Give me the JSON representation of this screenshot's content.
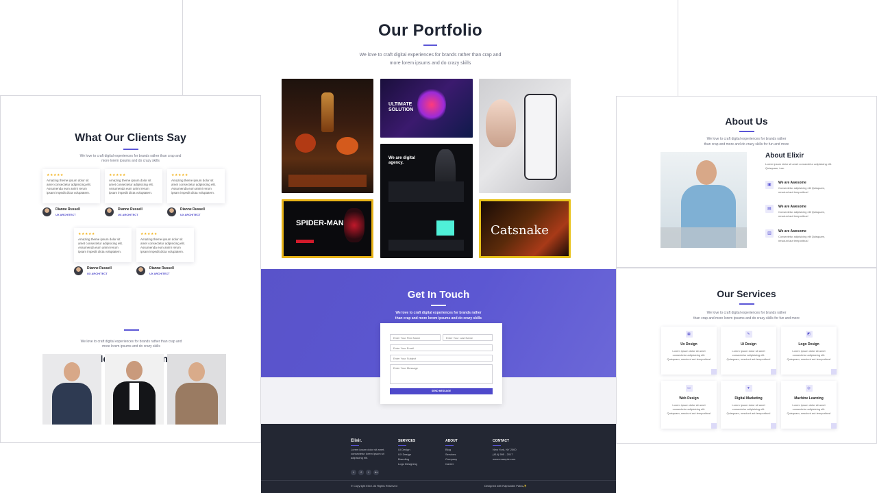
{
  "portfolio": {
    "title": "Our Portfolio",
    "subtitle_line1": "We love to craft digital experiences for brands rather than crap and",
    "subtitle_line2": "more lorem ipsums and do crazy skills",
    "tiles": {
      "ultimate": "ULTIMATE SOLUTION",
      "digital": "We are digital agency.",
      "spiderman": "SPIDER-MAN",
      "catsnake": "Catsnake"
    }
  },
  "clients": {
    "title": "What Our Clients Say",
    "subtitle_line1": "We love to craft digital experiences for brands rather than crap and",
    "subtitle_line2": "more lorem ipsums and do crazy skills",
    "stars": "★★★★★",
    "testimonial": "Amazing theme ipsum dolor sit amet consectetur adipisicing elit. Assumenda eum animi rerum ipsam impedit dicta voluptatem.",
    "author_name": "Dianne Russell",
    "author_role": "UX ARCHITECT"
  },
  "team": {
    "title": "Meet Our Team",
    "subtitle_line1": "We love to craft digital experiences for brands rather than crap and",
    "subtitle_line2": "more lorem ipsums and do crazy skills"
  },
  "contact": {
    "title": "Get In Touch",
    "subtitle_line1": "We love to craft digital experiences for brands rather",
    "subtitle_line2": "than crap and more lorem ipsums and do crazy skills",
    "first_name_placeholder": "Enter Your First Name",
    "last_name_placeholder": "Enter Your Last Name",
    "email_placeholder": "Enter Your Email",
    "subject_placeholder": "Enter Your Subject",
    "message_placeholder": "Enter Your Message",
    "submit_label": "SEND MESSAGE"
  },
  "footer": {
    "brand": "Elixir.",
    "brand_text": "Lorem ipsum dolor sit amet, consectetur lorem ipsum sit adipiscing elit.",
    "services_head": "SERVICES",
    "services_items": [
      "UI Design",
      "UX Design",
      "Branding",
      "Logo Designing"
    ],
    "about_head": "ABOUT",
    "about_items": [
      "Blog",
      "Services",
      "Company",
      "Career"
    ],
    "contact_head": "CONTACT",
    "contact_items": [
      "New York, NY 2000",
      "(414) 595 - 2017",
      "www.example.com"
    ],
    "copyright": "© Copyright Elixir. All Rights Reserved",
    "credit": "Designed with Rajnandini Patra ✨"
  },
  "about": {
    "title": "About Us",
    "subtitle_line1": "We love to craft digital experiences for brands rather",
    "subtitle_line2": "than crap and more and do crazy skills for fun and more",
    "heading": "About Elixir",
    "intro": "Lorem ipsum dolor sit amet consectetur adipisicing elit. Quisquam, iure.",
    "feature_title": "We are Awesome",
    "feature_text": "Consectetur adipisicing elit Quisquam, nesciunt aut temporibus!"
  },
  "services": {
    "title": "Our Services",
    "subtitle_line1": "We love to craft digital experiences for brands rather",
    "subtitle_line2": "than crap and more lorem ipsums and do crazy skills for fun and more",
    "card_text": "Lorem ipsum dolor sit amet consectetur adipisicing elit. Quisquam, nesciunt aut temporibus!",
    "items": [
      "Ux Design",
      "Ui Design",
      "Logo Design",
      "Web Design",
      "Digital Marketing",
      "Machine Learning"
    ]
  },
  "colors": {
    "accent": "#5a55d6",
    "dark": "#232733",
    "star": "#f2b21b"
  }
}
